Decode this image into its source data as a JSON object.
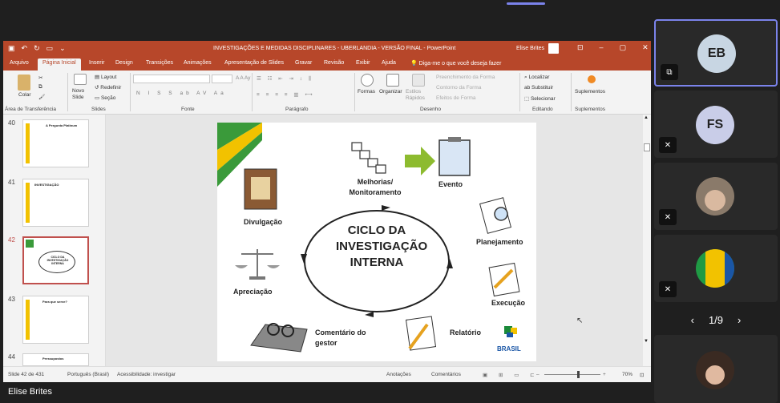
{
  "titlebar": {
    "doc_title": "INVESTIGAÇÕES E MEDIDAS DISCIPLINARES - UBERLANDIA - VERSÃO FINAL - PowerPoint",
    "user": "Elise Brites"
  },
  "menu": [
    "Arquivo",
    "Página Inicial",
    "Inserir",
    "Design",
    "Transições",
    "Animações",
    "Apresentação de Slides",
    "Gravar",
    "Revisão",
    "Exibir",
    "Ajuda",
    "Diga-me o que você deseja fazer"
  ],
  "ribbon": {
    "paste": "Colar",
    "new_slide": "Novo Slide",
    "layout": "Layout",
    "reset": "Redefinir",
    "section": "Seção",
    "font_btns": [
      "N",
      "I",
      "S",
      "S",
      "ab",
      "AV",
      "Aa"
    ],
    "shapes": "Formas",
    "arrange": "Organizar",
    "quick_styles": "Estilos Rápidos",
    "fill": "Preenchimento da Forma",
    "outline": "Contorno da Forma",
    "effects": "Efeitos de Forma",
    "find": "Localizar",
    "replace": "Substituir",
    "select": "Selecionar",
    "addins": "Suplementos",
    "groups": {
      "clipboard": "Área de Transferência",
      "slides": "Slides",
      "font": "Fonte",
      "paragraph": "Parágrafo",
      "drawing": "Desenho",
      "editing": "Editando",
      "addins": "Suplementos"
    }
  },
  "thumbnails": [
    {
      "num": "40",
      "title": "A Pergunta Platinum"
    },
    {
      "num": "41",
      "title": "INVESTIGAÇÃO"
    },
    {
      "num": "42",
      "title": "CICLO DA INVESTIGAÇÃO INTERNA"
    },
    {
      "num": "43",
      "title": "Para que serve?"
    },
    {
      "num": "44",
      "title": "Pressupostos"
    }
  ],
  "slide": {
    "center": "CICLO DA INVESTIGAÇÃO INTERNA",
    "labels": {
      "melhorias": "Melhorias/ Monitoramento",
      "evento": "Evento",
      "divulgacao": "Divulgação",
      "planejamento": "Planejamento",
      "apreciacao": "Apreciação",
      "execucao": "Execução",
      "comentario": "Comentário do gestor",
      "relatorio": "Relatório",
      "logo_text": "BRASIL"
    }
  },
  "status": {
    "slide_count": "Slide 42 de 431",
    "language": "Português (Brasil)",
    "accessibility": "Acessibilidade: investigar",
    "notes": "Anotações",
    "comments": "Comentários",
    "zoom": "70%"
  },
  "participants": [
    {
      "initials": "EB",
      "color": "#c8d6e3"
    },
    {
      "initials": "FS",
      "color": "#c9cde8"
    }
  ],
  "pager": "1/9",
  "presenter_name": "Elise Brites"
}
